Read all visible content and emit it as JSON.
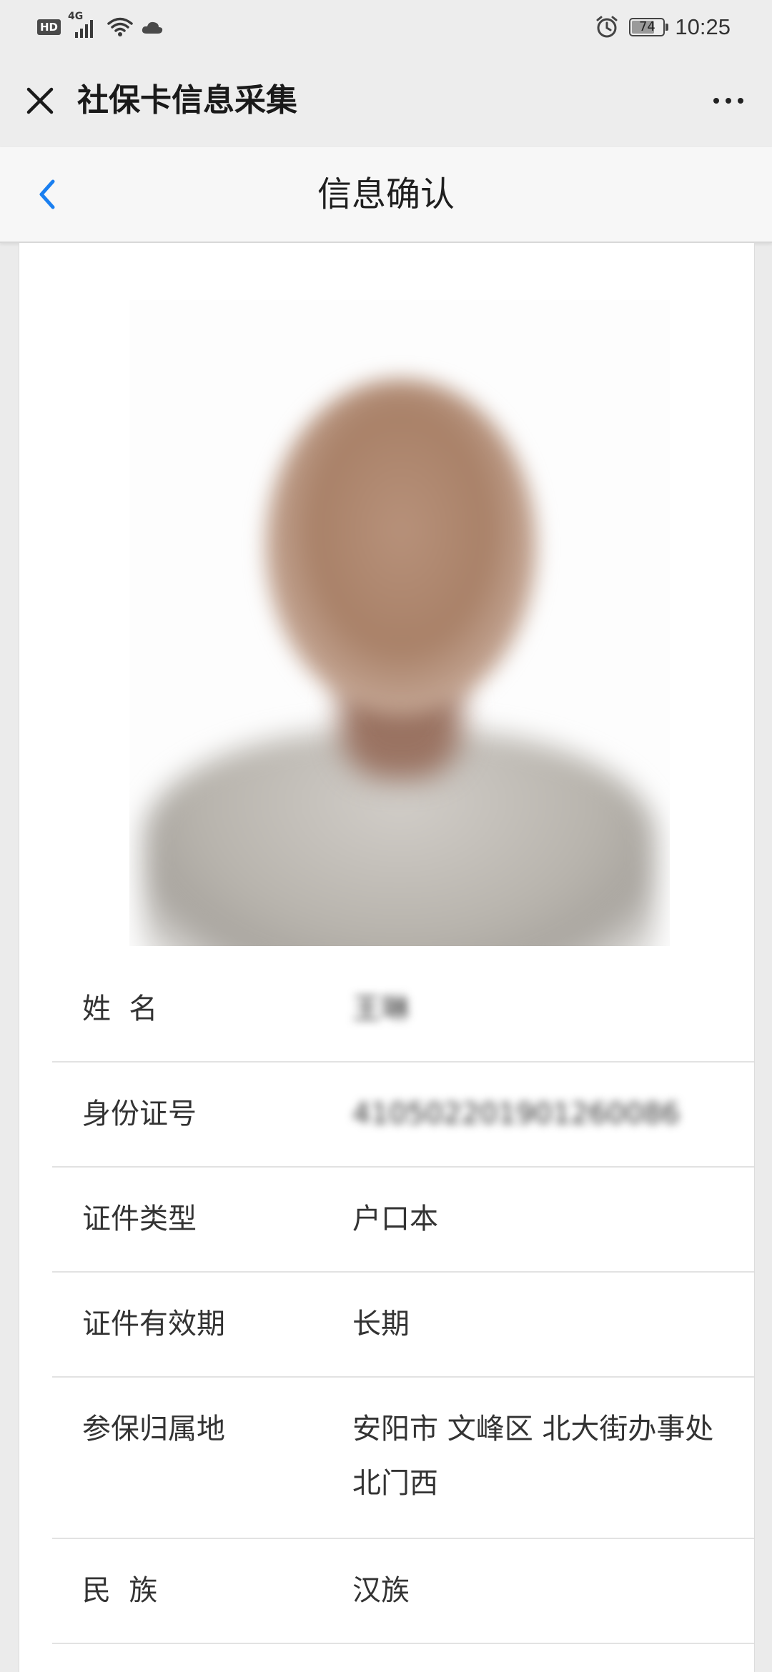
{
  "status_bar": {
    "hd_label": "HD",
    "network_label": "4G",
    "battery_level": 74,
    "battery_text": "74",
    "time": "10:25"
  },
  "app_bar": {
    "title": "社保卡信息采集"
  },
  "nav_bar": {
    "title": "信息确认"
  },
  "info": {
    "rows": [
      {
        "label": "姓  名",
        "value": "王琳"
      },
      {
        "label": "身份证号",
        "value": "410502201901260086"
      },
      {
        "label": "证件类型",
        "value": "户口本"
      },
      {
        "label": "证件有效期",
        "value": "长期"
      },
      {
        "label": "参保归属地",
        "value": "安阳市 文峰区 北大街办事处 北门西"
      },
      {
        "label": "民  族",
        "value": "汉族"
      }
    ]
  },
  "colors": {
    "accent": "#1a7ff0",
    "background": "#ebebeb",
    "card": "#ffffff"
  }
}
